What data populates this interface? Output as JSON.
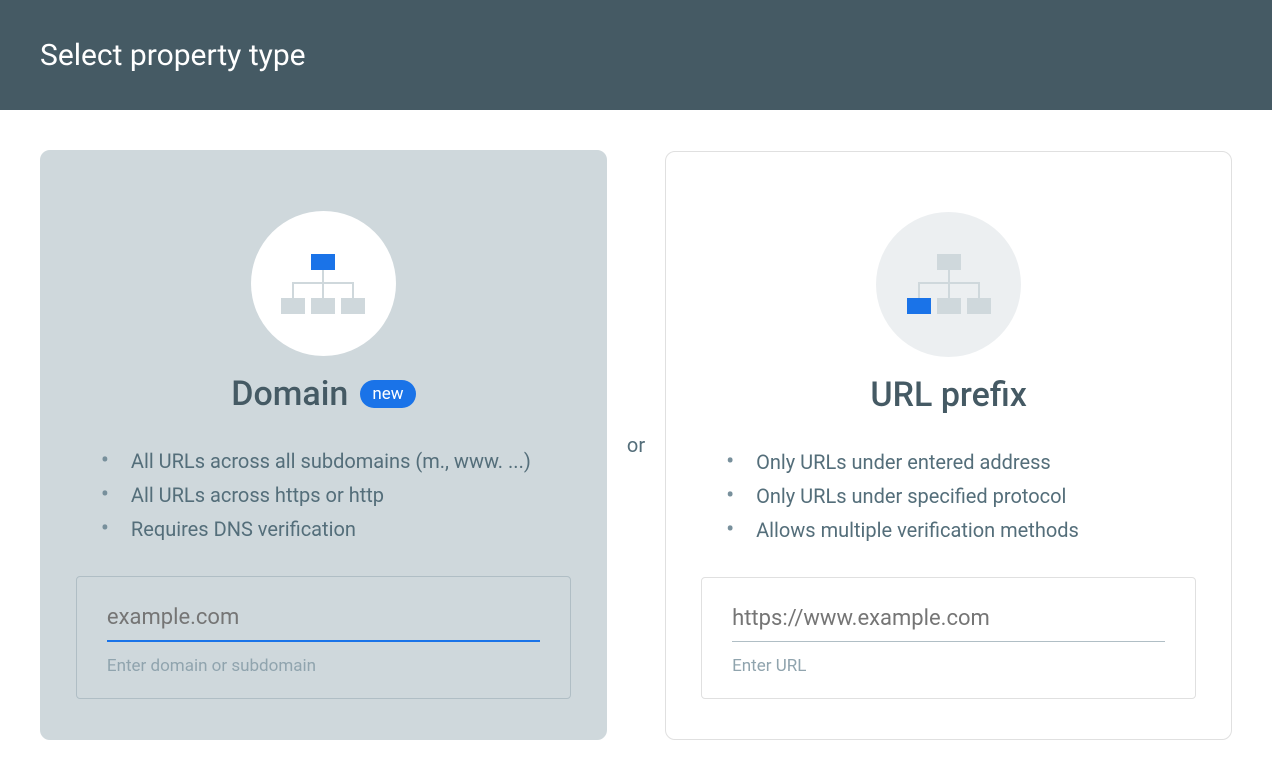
{
  "header": {
    "title": "Select property type"
  },
  "separator": "or",
  "domainCard": {
    "title": "Domain",
    "badge": "new",
    "features": [
      "All URLs across all subdomains (m., www. ...)",
      "All URLs across https or http",
      "Requires DNS verification"
    ],
    "input": {
      "placeholder": "example.com",
      "helper": "Enter domain or subdomain"
    }
  },
  "urlCard": {
    "title": "URL prefix",
    "features": [
      "Only URLs under entered address",
      "Only URLs under specified protocol",
      "Allows multiple verification methods"
    ],
    "input": {
      "placeholder": "https://www.example.com",
      "helper": "Enter URL"
    }
  }
}
